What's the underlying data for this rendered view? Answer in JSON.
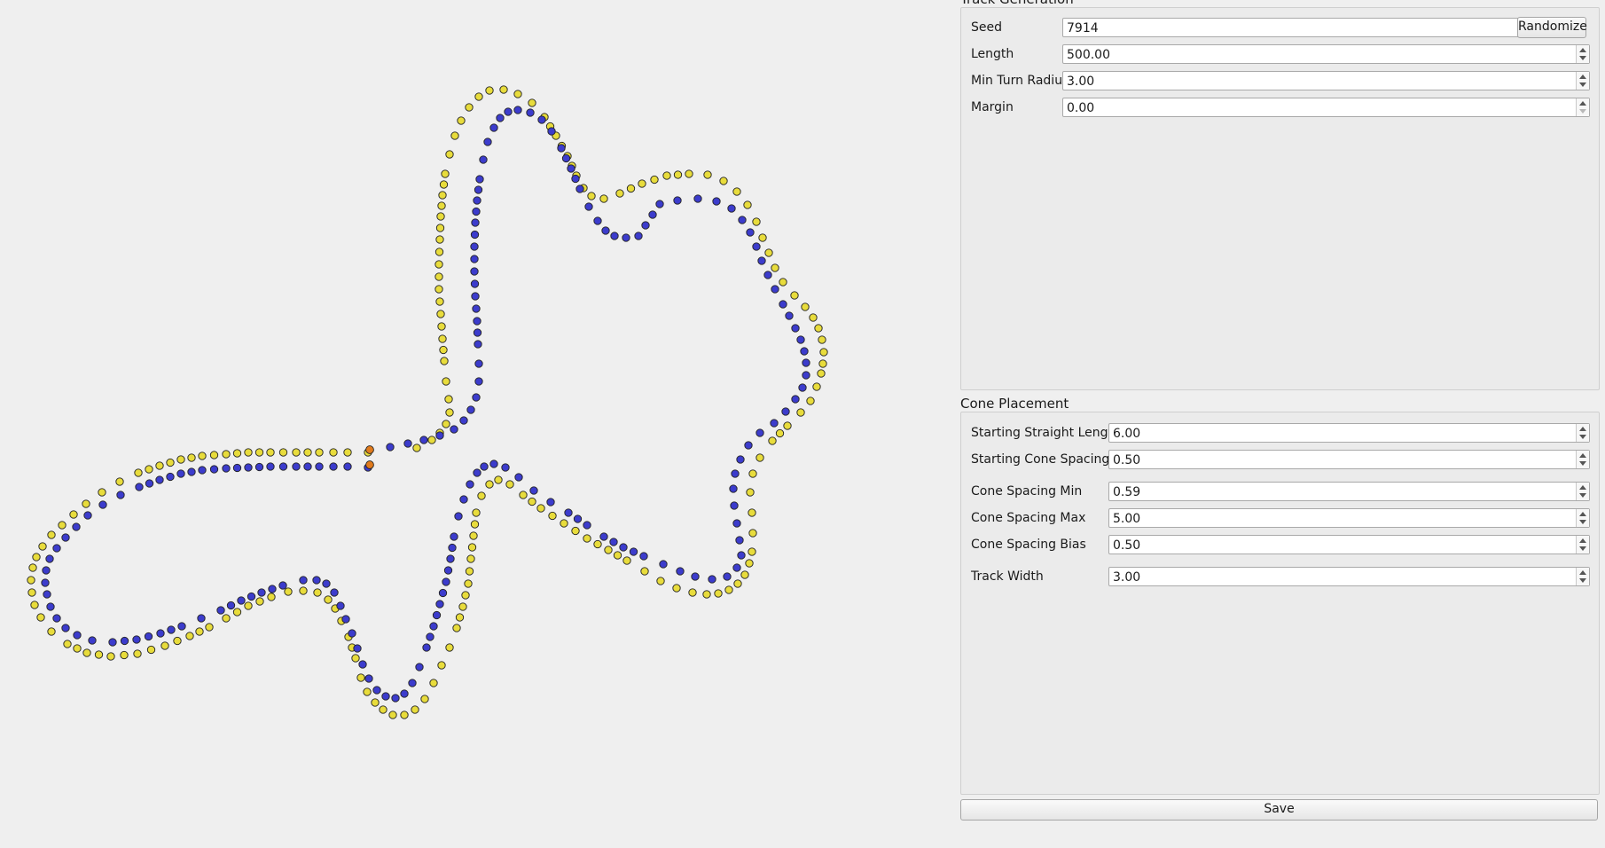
{
  "track_generation": {
    "title": "Track Generation",
    "seed": {
      "label": "Seed",
      "value": "7914"
    },
    "randomize_label": "Randomize",
    "length": {
      "label": "Length",
      "value": "500.00"
    },
    "min_turn_radius": {
      "label": "Min Turn Radius",
      "value": "3.00"
    },
    "margin": {
      "label": "Margin",
      "value": "0.00"
    }
  },
  "cone_placement": {
    "title": "Cone Placement",
    "starting_straight_length": {
      "label": "Starting Straight  Length",
      "value": "6.00"
    },
    "starting_cone_spacing": {
      "label": "Starting Cone Spacing",
      "value": "0.50"
    },
    "cone_spacing_min": {
      "label": "Cone Spacing Min",
      "value": "0.59"
    },
    "cone_spacing_max": {
      "label": "Cone Spacing Max",
      "value": "5.00"
    },
    "cone_spacing_bias": {
      "label": "Cone Spacing Bias",
      "value": "0.50"
    },
    "track_width": {
      "label": "Track Width",
      "value": "3.00"
    }
  },
  "save_label": "Save",
  "colors": {
    "yellow_cone": "#e8dc3c",
    "blue_cone": "#3c3ccc",
    "orange_cone": "#e07a1c",
    "cone_outline": "#222222"
  }
}
